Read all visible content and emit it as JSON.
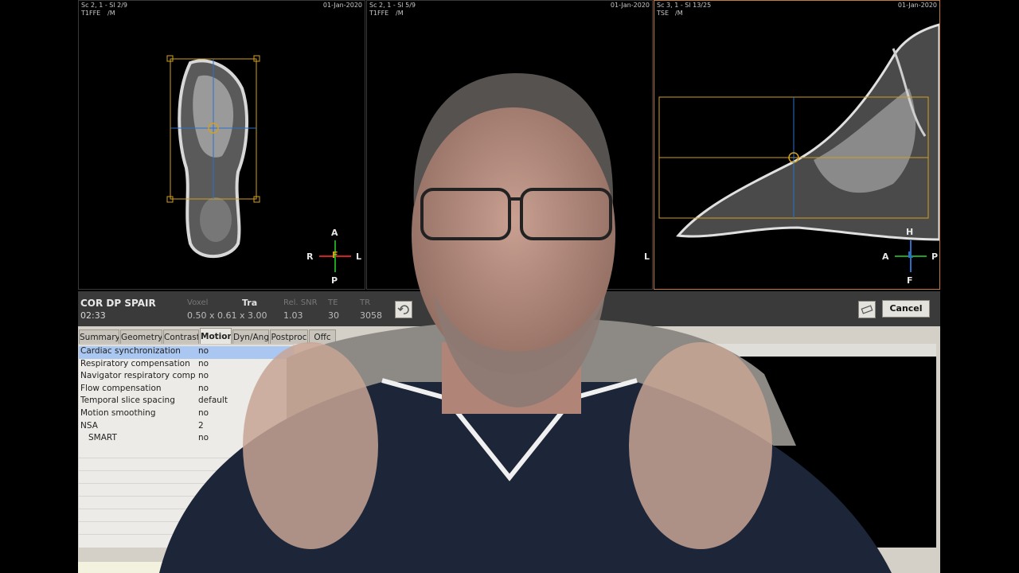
{
  "viewports": [
    {
      "series": "Sc 2, 1 - Sl 2/9",
      "date": "01-Jan-2020",
      "sequence": "T1FFE",
      "flag": "/M",
      "orient": {
        "top": "A",
        "bottom": "P",
        "left": "R",
        "right": "L",
        "center": "F"
      }
    },
    {
      "series": "Sc 2, 1 - Sl 5/9",
      "date": "01-Jan-2020",
      "sequence": "T1FFE",
      "flag": "/M",
      "orient": {
        "right": "L"
      }
    },
    {
      "series": "Sc 3, 1 - Sl 13/25",
      "date": "01-Jan-2020",
      "sequence": "TSE",
      "flag": "/M",
      "orient": {
        "top": "H",
        "bottom": "F",
        "left": "A",
        "right": "P",
        "center": "L"
      }
    }
  ],
  "scan": {
    "name": "COR DP SPAIR",
    "duration": "02:33",
    "voxel_label": "Voxel",
    "voxel_value": "0.50 x 0.61 x 3.00",
    "orientation": "Tra",
    "snr_label": "Rel. SNR",
    "snr_value": "1.03",
    "te_label": "TE",
    "te_value": "30",
    "tr_label": "TR",
    "tr_value": "3058"
  },
  "buttons": {
    "cancel": "Cancel"
  },
  "tabs": [
    "Summary",
    "Geometry",
    "Contrast",
    "Motion",
    "Dyn/Ang",
    "Postproc",
    "Offc"
  ],
  "selected_tab": "Motion",
  "params": [
    {
      "name": "Cardiac synchronization",
      "value": "no"
    },
    {
      "name": "Respiratory compensation",
      "value": "no"
    },
    {
      "name": "Navigator respiratory comp",
      "value": "no"
    },
    {
      "name": "Flow compensation",
      "value": "no"
    },
    {
      "name": "Temporal slice spacing",
      "value": "default"
    },
    {
      "name": "Motion smoothing",
      "value": "no"
    },
    {
      "name": "NSA",
      "value": "2"
    },
    {
      "name": "   SMART",
      "value": "no"
    }
  ],
  "colors": {
    "active_border": "#c87a3a",
    "planning_box": "#d4a020",
    "highlight_row": "#a9c7f0",
    "panel": "#d4d0c8"
  }
}
